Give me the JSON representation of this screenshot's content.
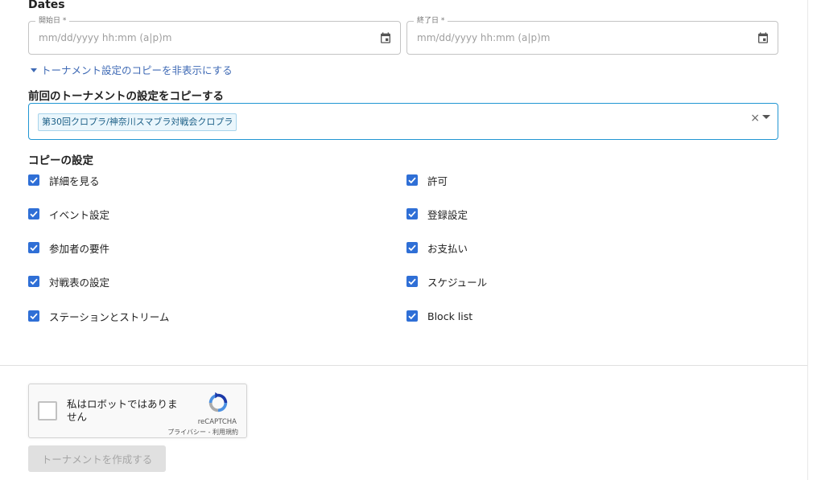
{
  "dates": {
    "section_title": "Dates",
    "start": {
      "label": "開始日 *",
      "placeholder": "mm/dd/yyyy hh:mm (a|p)m"
    },
    "end": {
      "label": "終了日 *",
      "placeholder": "mm/dd/yyyy hh:mm (a|p)m"
    }
  },
  "toggle_copy": {
    "label": "トーナメント設定のコピーを非表示にする"
  },
  "copy_from": {
    "label": "前回のトーナメントの設定をコピーする",
    "selected": "第30回クロプラ/神奈川スマブラ対戦会クロプラ",
    "clear_symbol": "×"
  },
  "copy_settings": {
    "title": "コピーの設定",
    "left": [
      {
        "label": "詳細を見る",
        "checked": true
      },
      {
        "label": "イベント設定",
        "checked": true
      },
      {
        "label": "参加者の要件",
        "checked": true
      },
      {
        "label": "対戦表の設定",
        "checked": true
      },
      {
        "label": "ステーションとストリーム",
        "checked": true
      }
    ],
    "right": [
      {
        "label": "許可",
        "checked": true
      },
      {
        "label": "登録設定",
        "checked": true
      },
      {
        "label": "お支払い",
        "checked": true
      },
      {
        "label": "スケジュール",
        "checked": true
      },
      {
        "label": "Block list",
        "checked": true
      }
    ]
  },
  "recaptcha": {
    "text": "私はロボットではありません",
    "brand": "reCAPTCHA",
    "links": "プライバシー - 利用規約"
  },
  "submit": {
    "label": "トーナメントを作成する"
  },
  "colors": {
    "accent": "#2f6fd6",
    "link": "#3f6ab5",
    "select_border": "#2196d3"
  }
}
